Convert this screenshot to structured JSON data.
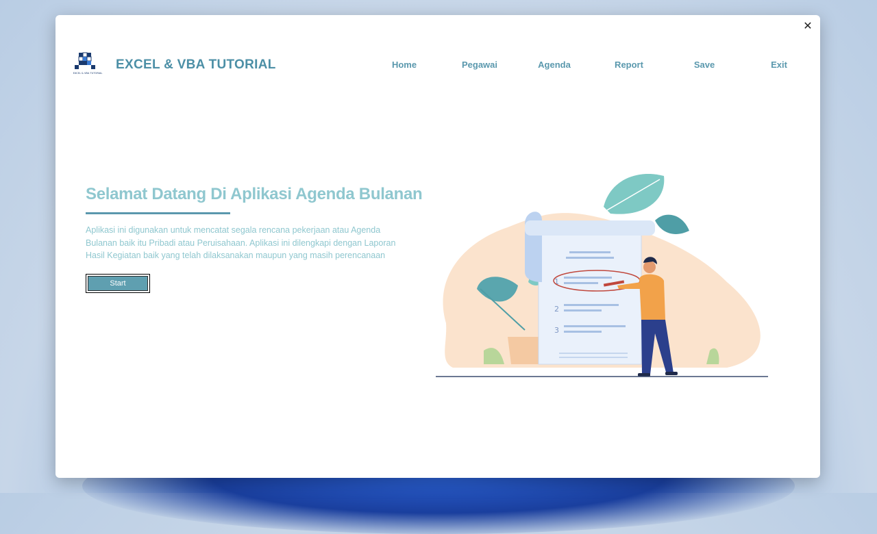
{
  "window": {
    "brand": "EXCEL & VBA TUTORIAL",
    "logo_caption": "EXCEL & VBA TUTORIAL",
    "close_label": "✕"
  },
  "nav": {
    "items": [
      {
        "label": "Home"
      },
      {
        "label": "Pegawai"
      },
      {
        "label": "Agenda"
      },
      {
        "label": "Report"
      },
      {
        "label": "Save"
      },
      {
        "label": "Exit"
      }
    ]
  },
  "main": {
    "title": "Selamat Datang Di Aplikasi Agenda Bulanan",
    "description": "Aplikasi ini digunakan untuk mencatat segala rencana pekerjaan atau Agenda Bulanan baik itu Pribadi atau Peruisahaan. Aplikasi ini dilengkapi dengan Laporan Hasil Kegiatan baik yang telah dilaksanakan maupun yang masih perencanaan",
    "start_label": "Start"
  },
  "illustration": {
    "list_numbers": [
      "1",
      "2",
      "3"
    ]
  },
  "colors": {
    "accent": "#5a98ad",
    "title": "#8fc7cf",
    "button": "#5f9fb0"
  }
}
